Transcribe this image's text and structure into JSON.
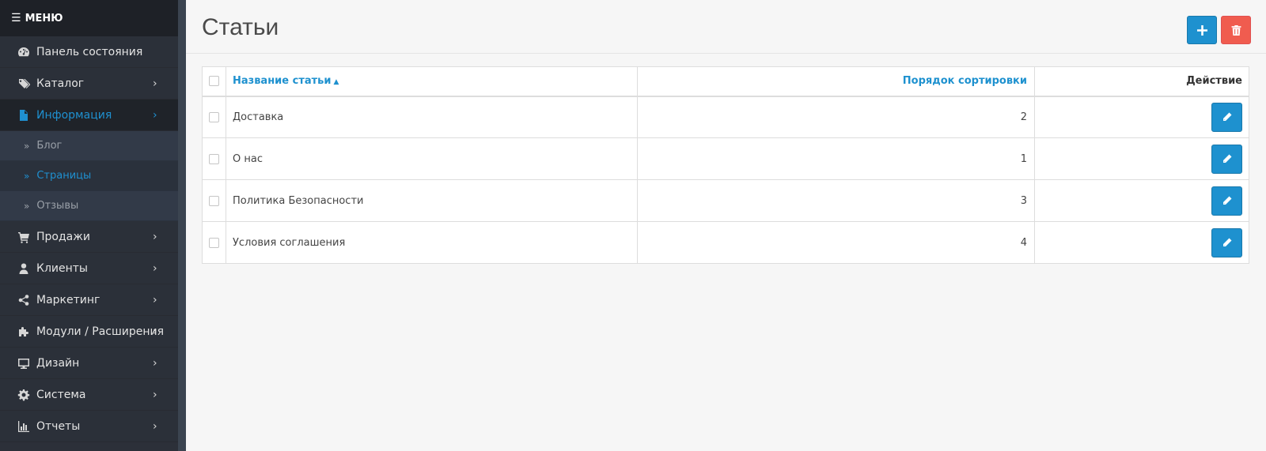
{
  "sidebar": {
    "menu_label": "МЕНЮ",
    "items": [
      {
        "label": "Панель состояния",
        "icon": "dashboard-icon"
      },
      {
        "label": "Каталог",
        "icon": "tags-icon"
      },
      {
        "label": "Информация",
        "icon": "file-icon"
      },
      {
        "label": "Продажи",
        "icon": "cart-icon"
      },
      {
        "label": "Клиенты",
        "icon": "user-icon"
      },
      {
        "label": "Маркетинг",
        "icon": "share-icon"
      },
      {
        "label": "Модули / Расширения",
        "icon": "puzzle-icon"
      },
      {
        "label": "Дизайн",
        "icon": "monitor-icon"
      },
      {
        "label": "Система",
        "icon": "gear-icon"
      },
      {
        "label": "Отчеты",
        "icon": "bar-chart-icon"
      }
    ],
    "subitems": [
      {
        "label": "Блог"
      },
      {
        "label": "Страницы"
      },
      {
        "label": "Отзывы"
      }
    ]
  },
  "page": {
    "title": "Статьи"
  },
  "table": {
    "headers": {
      "name": "Название статьи",
      "sort": "Порядок сортировки",
      "action": "Действие"
    },
    "rows": [
      {
        "name": "Доставка",
        "sort": "2"
      },
      {
        "name": "О нас",
        "sort": "1"
      },
      {
        "name": "Политика Безопасности",
        "sort": "3"
      },
      {
        "name": "Условия соглашения",
        "sort": "4"
      }
    ]
  },
  "colors": {
    "accent": "#1e91cf",
    "danger": "#f05c4f",
    "sidebar_bg": "#2c3039"
  }
}
